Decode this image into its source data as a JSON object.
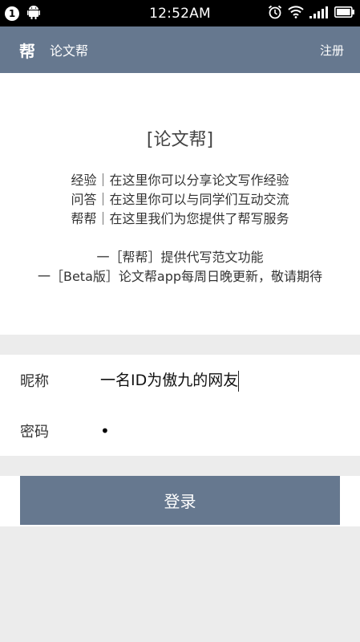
{
  "status_bar": {
    "notification_count": "1",
    "time": "12:52AM"
  },
  "header": {
    "logo_text": "帮",
    "title": "论文帮",
    "register_label": "注册"
  },
  "intro": {
    "title": "[论文帮]",
    "lines": [
      "经验｜在这里你可以分享论文写作经验",
      "问答｜在这里你可以与同学们互动交流",
      "帮帮｜在这里我们为您提供了帮写服务"
    ],
    "notes": [
      "一［帮帮］提供代写范文功能",
      "一［Beta版］论文帮app每周日晚更新，敬请期待"
    ]
  },
  "form": {
    "nickname_label": "昵称",
    "nickname_value": "一名ID为傲九的网友",
    "password_label": "密码",
    "password_value": "•"
  },
  "login_button": "登录",
  "colors": {
    "primary": "#66788f",
    "background": "#ececec"
  }
}
